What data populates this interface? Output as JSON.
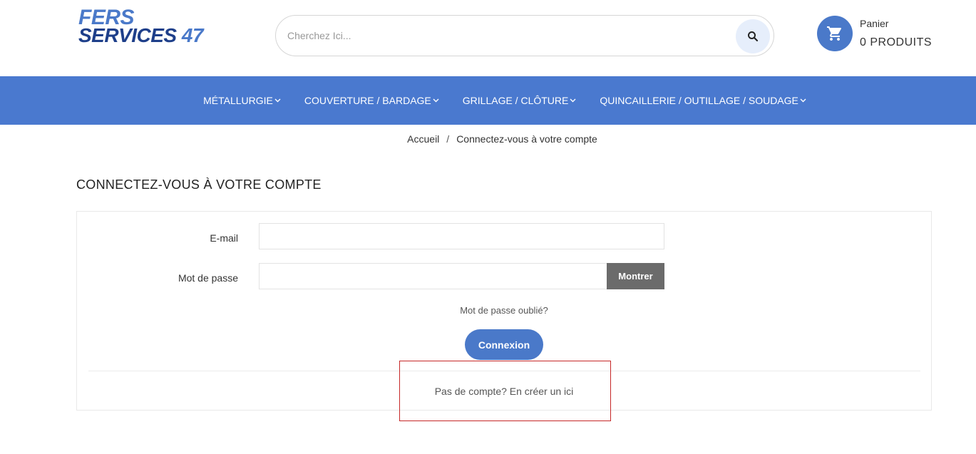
{
  "header": {
    "logo_line1": "FERS",
    "logo_line2": "SERVICES",
    "logo_number": "47",
    "search_placeholder": "Cherchez Ici...",
    "cart_label": "Panier",
    "cart_count": "0 PRODUITS"
  },
  "nav": {
    "items": [
      {
        "label": "MÉTALLURGIE"
      },
      {
        "label": "COUVERTURE / BARDAGE"
      },
      {
        "label": "GRILLAGE / CLÔTURE"
      },
      {
        "label": "QUINCAILLERIE / OUTILLAGE / SOUDAGE"
      }
    ]
  },
  "breadcrumb": {
    "home": "Accueil",
    "separator": "/",
    "current": "Connectez-vous à votre compte"
  },
  "page": {
    "title": "CONNECTEZ-VOUS À VOTRE COMPTE"
  },
  "form": {
    "email_label": "E-mail",
    "email_value": "",
    "password_label": "Mot de passe",
    "password_value": "",
    "show_button": "Montrer",
    "forgot_link": "Mot de passe oublié?",
    "login_button": "Connexion",
    "no_account_link": "Pas de compte? En créer un ici"
  },
  "colors": {
    "brand_blue": "#4a79c9",
    "brand_dark": "#1e3f8a",
    "highlight": "#c62828"
  }
}
